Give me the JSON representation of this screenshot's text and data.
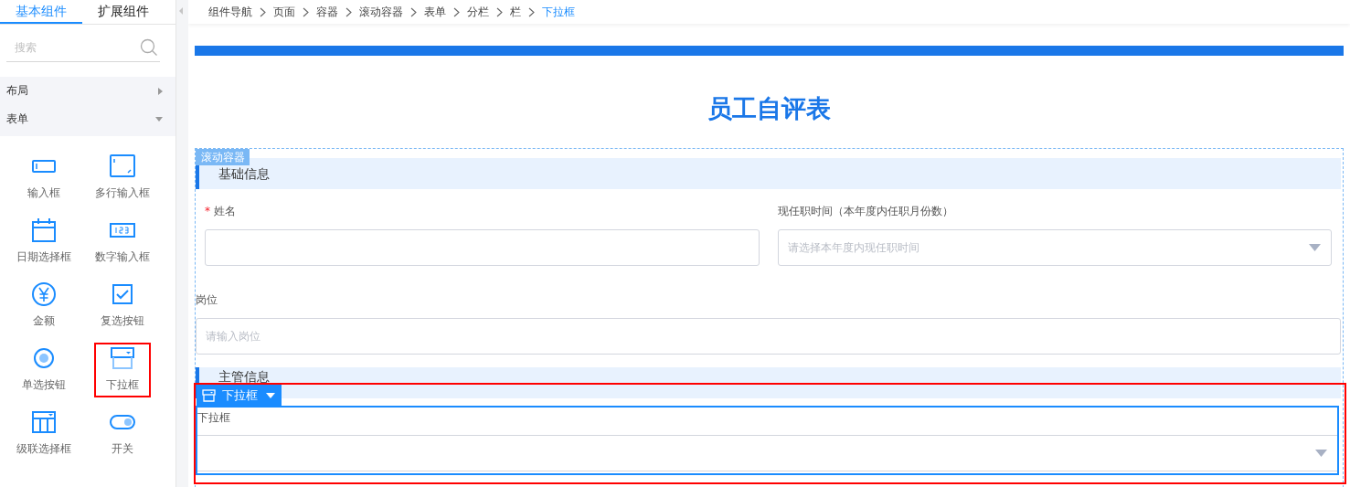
{
  "sidebar": {
    "tabs": [
      {
        "label": "基本组件",
        "selected": true
      },
      {
        "label": "扩展组件",
        "selected": false
      }
    ],
    "search": {
      "placeholder": "搜索"
    },
    "categories": [
      {
        "label": "布局",
        "expanded": false
      },
      {
        "label": "表单",
        "expanded": true
      }
    ],
    "components": [
      {
        "label": "输入框",
        "kind": "input",
        "highlighted": false
      },
      {
        "label": "多行输入框",
        "kind": "textarea",
        "highlighted": false
      },
      {
        "label": "日期选择框",
        "kind": "date",
        "highlighted": false
      },
      {
        "label": "数字输入框",
        "kind": "number",
        "highlighted": false
      },
      {
        "label": "金额",
        "kind": "money",
        "highlighted": false
      },
      {
        "label": "复选按钮",
        "kind": "checkbox",
        "highlighted": false
      },
      {
        "label": "单选按钮",
        "kind": "radio",
        "highlighted": false
      },
      {
        "label": "下拉框",
        "kind": "select",
        "highlighted": true
      },
      {
        "label": "级联选择框",
        "kind": "cascader",
        "highlighted": false
      },
      {
        "label": "开关",
        "kind": "switch",
        "highlighted": false
      }
    ]
  },
  "breadcrumb": [
    {
      "label": "组件导航",
      "current": false
    },
    {
      "label": "页面",
      "current": false
    },
    {
      "label": "容器",
      "current": false
    },
    {
      "label": "滚动容器",
      "current": false
    },
    {
      "label": "表单",
      "current": false
    },
    {
      "label": "分栏",
      "current": false
    },
    {
      "label": "栏",
      "current": false
    },
    {
      "label": "下拉框",
      "current": true
    }
  ],
  "form": {
    "title": "员工自评表",
    "container_tag": "滚动容器",
    "sections": [
      {
        "title": "基础信息",
        "rows": [
          {
            "kind": "columns",
            "fields": [
              {
                "label": "姓名",
                "required_mark": "*",
                "kind": "input",
                "selected": false
              },
              {
                "label": "现任职时间（本年度内任职月份数）",
                "kind": "select",
                "placeholder": "请选择本年度内现任职时间",
                "selected": false
              }
            ]
          },
          {
            "kind": "single",
            "fields": [
              {
                "label": "岗位",
                "kind": "input",
                "placeholder": "请输入岗位",
                "selected": false
              }
            ]
          }
        ]
      },
      {
        "title": "主管信息",
        "rows": [
          {
            "kind": "single",
            "fields": [
              {
                "label": "下拉框",
                "kind": "select",
                "selected": true
              }
            ]
          }
        ]
      }
    ],
    "selection_toolbar": {
      "label": "下拉框"
    }
  }
}
